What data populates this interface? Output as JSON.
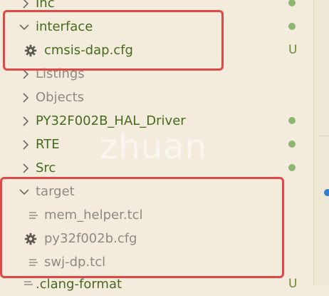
{
  "explorer": {
    "items": [
      {
        "label": "Inc",
        "kind": "folder",
        "expanded": false,
        "status": "dot"
      },
      {
        "label": "interface",
        "kind": "folder",
        "expanded": true,
        "status": "dot"
      },
      {
        "label": "cmsis-dap.cfg",
        "kind": "cfg-file",
        "status": "U"
      },
      {
        "label": "Listings",
        "kind": "folder",
        "expanded": false,
        "status": ""
      },
      {
        "label": "Objects",
        "kind": "folder",
        "expanded": false,
        "status": ""
      },
      {
        "label": "PY32F002B_HAL_Driver",
        "kind": "folder",
        "expanded": false,
        "status": "dot"
      },
      {
        "label": "RTE",
        "kind": "folder",
        "expanded": false,
        "status": "dot"
      },
      {
        "label": "Src",
        "kind": "folder",
        "expanded": false,
        "status": "dot"
      },
      {
        "label": "target",
        "kind": "folder",
        "expanded": true,
        "status": ""
      },
      {
        "label": "mem_helper.tcl",
        "kind": "tcl-file",
        "status": ""
      },
      {
        "label": "py32f002b.cfg",
        "kind": "cfg-file",
        "status": ""
      },
      {
        "label": "swj-dp.tcl",
        "kind": "tcl-file",
        "status": ""
      },
      {
        "label": ".clang-format",
        "kind": "file",
        "status": "U"
      }
    ]
  },
  "watermark": "zhuan",
  "colors": {
    "highlight": "#e04846",
    "git_dot": "#8fb573",
    "untracked": "#6f8a33",
    "background": "#f3ecdc"
  }
}
